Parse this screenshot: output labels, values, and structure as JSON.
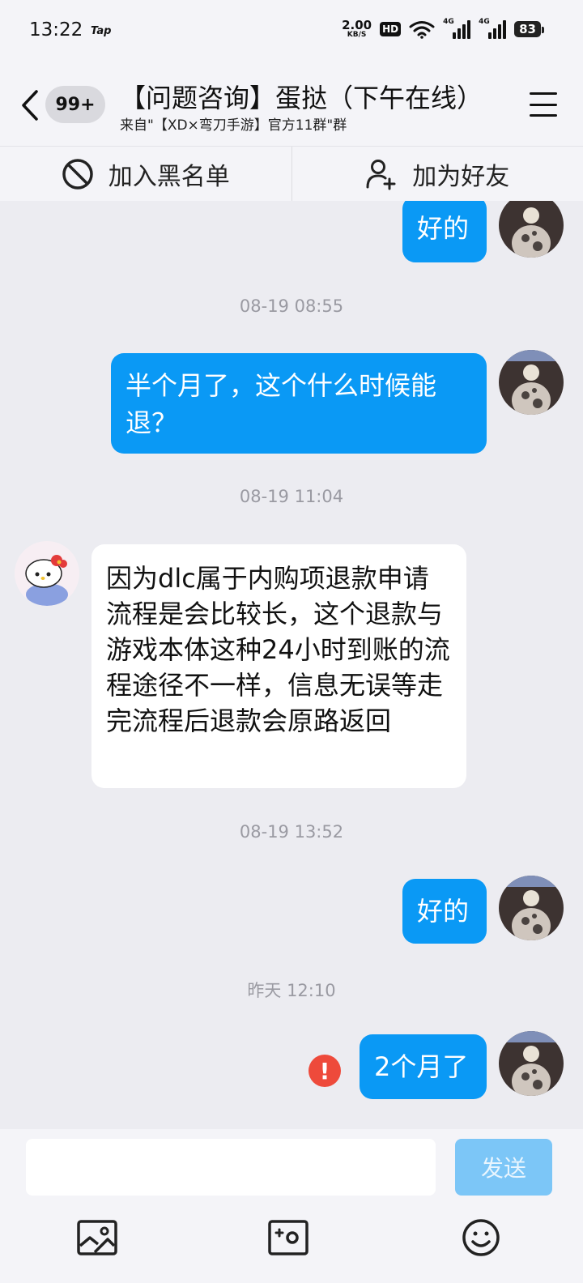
{
  "status_bar": {
    "time": "13:22",
    "app_tag": "Tap",
    "net_speed_value": "2.00",
    "net_speed_unit": "KB/S",
    "hd_label": "HD",
    "signal1_label": "4G",
    "signal2_label": "4G",
    "battery": "83"
  },
  "header": {
    "unread_count": "99+",
    "title": "【问题咨询】蛋挞（下午在线）",
    "subtitle": "来自\"【XD×弯刀手游】官方11群\"群"
  },
  "actions": {
    "block_label": "加入黑名单",
    "add_friend_label": "加为好友"
  },
  "messages": {
    "m1": "好的",
    "ts1": "08-19 08:55",
    "m2": "半个月了，这个什么时候能退？",
    "ts2": "08-19 11:04",
    "m3": "因为dlc属于内购项退款申请流程是会比较长，这个退款与游戏本体这种24小时到账的流程途径不一样，信息无误等走完流程后退款会原路返回",
    "ts3": "08-19 13:52",
    "m4": "好的",
    "ts4": "昨天 12:10",
    "m5": "2个月了",
    "failed_icon": "!"
  },
  "input": {
    "placeholder": "",
    "send_label": "发送"
  },
  "icons": {
    "back": "chevron-left-icon",
    "menu": "hamburger-menu-icon",
    "block": "ban-icon",
    "add_friend": "user-plus-icon",
    "image": "image-icon",
    "camera": "camera-icon",
    "emoji": "emoji-icon"
  },
  "colors": {
    "accent": "#0a99f5",
    "send_disabled": "#7cc6f7",
    "error": "#ee4a3b",
    "background": "#ececf1"
  }
}
